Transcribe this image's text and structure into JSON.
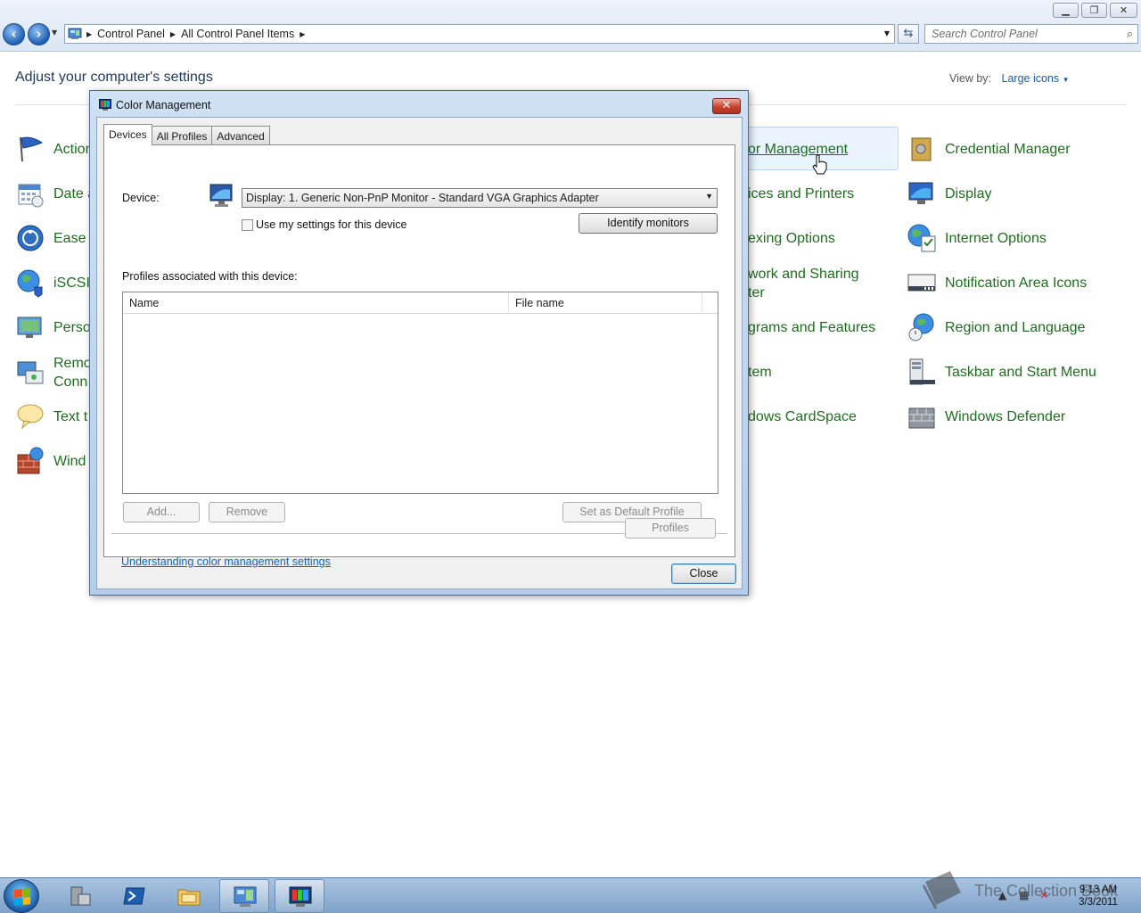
{
  "window": {
    "caption_buttons": [
      "minimize",
      "restore",
      "close"
    ]
  },
  "address": {
    "crumbs": [
      "Control Panel",
      "All Control Panel Items"
    ],
    "search_placeholder": "Search Control Panel"
  },
  "content": {
    "heading": "Adjust your computer's settings",
    "view_by_label": "View by:",
    "view_by_value": "Large icons",
    "left_items": [
      {
        "label": "Action",
        "icon": "action-center-flag-icon"
      },
      {
        "label": "Date a",
        "icon": "calendar-icon"
      },
      {
        "label": "Ease o",
        "icon": "ease-of-access-icon"
      },
      {
        "label": "iSCSI",
        "icon": "iscsi-globe-icon"
      },
      {
        "label": "Perso",
        "icon": "personalization-monitor-icon"
      },
      {
        "label": "Remo",
        "label2": "Conn",
        "icon": "remote-connection-icon"
      },
      {
        "label": "Text t",
        "icon": "speech-bubble-icon"
      },
      {
        "label": "Wind",
        "icon": "firewall-icon"
      }
    ],
    "mid_items": [
      {
        "label": "or Management"
      },
      {
        "label": "ices and Printers"
      },
      {
        "label": "exing Options"
      },
      {
        "label": "work and Sharing",
        "label2": "ter"
      },
      {
        "label": "grams and Features"
      },
      {
        "label": "tem"
      },
      {
        "label": "dows CardSpace"
      }
    ],
    "right_items": [
      {
        "label": "Credential Manager",
        "icon": "credential-vault-icon"
      },
      {
        "label": "Display",
        "icon": "display-monitor-icon"
      },
      {
        "label": "Internet Options",
        "icon": "internet-options-icon"
      },
      {
        "label": "Notification Area Icons",
        "icon": "notification-area-icon"
      },
      {
        "label": "Region and Language",
        "icon": "region-globe-clock-icon"
      },
      {
        "label": "Taskbar and Start Menu",
        "icon": "taskbar-icon"
      },
      {
        "label": "Windows Defender",
        "icon": "windows-defender-wall-icon"
      }
    ]
  },
  "dialog": {
    "title": "Color Management",
    "close_glyph": "✕",
    "tabs": [
      "Devices",
      "All Profiles",
      "Advanced"
    ],
    "active_tab": "Devices",
    "device_label": "Device:",
    "device_value": "Display: 1. Generic Non-PnP Monitor - Standard VGA Graphics Adapter",
    "use_settings_label": "Use my settings for this device",
    "use_settings_checked": false,
    "identify_button": "Identify monitors",
    "profiles_label": "Profiles associated with this device:",
    "columns": [
      "Name",
      "File name"
    ],
    "rows": [],
    "add_button": "Add...",
    "remove_button": "Remove",
    "set_default_button": "Set as Default Profile",
    "link_text": "Understanding color management settings",
    "profiles_button": "Profiles",
    "close_button": "Close"
  },
  "taskbar": {
    "apps": [
      "server-manager",
      "powershell",
      "windows-explorer",
      "control-panel",
      "color-management"
    ],
    "watermark": "The Collection Book",
    "time": "9:13 AM",
    "date": "3/3/2011"
  },
  "colors": {
    "link_green": "#1e6d1e",
    "link_blue": "#0b61c3",
    "heading_blue": "#1e395b"
  }
}
